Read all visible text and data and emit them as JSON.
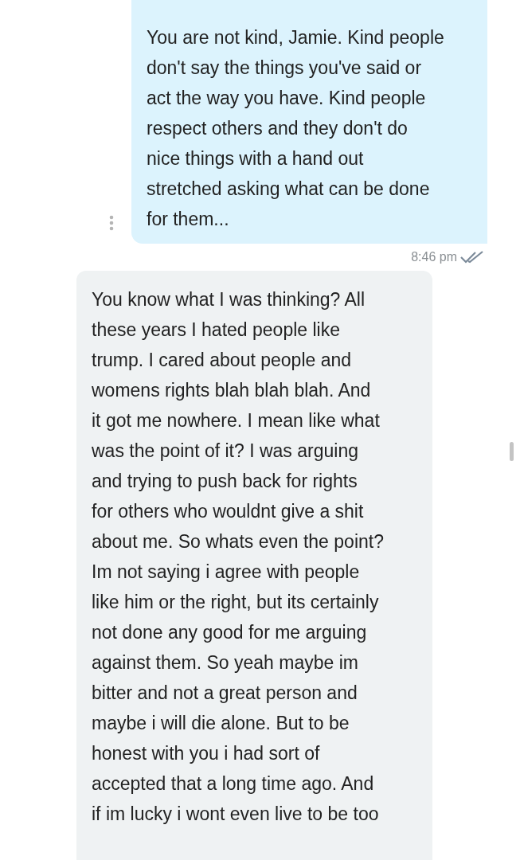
{
  "messages": [
    {
      "kind": "sent",
      "lines": [
        "You are not kind, Jamie. Kind people",
        "don't say the things you've said or",
        "act the way you have. Kind people",
        "respect others and they don't do",
        "nice things with a hand out",
        "stretched asking what can be done",
        "for them..."
      ],
      "time": "8:46 pm",
      "read": true
    },
    {
      "kind": "received",
      "lines": [
        "You know what I was thinking? All",
        "these years I hated people like",
        "trump. I cared about people and",
        "womens rights blah blah blah. And",
        "it got me nowhere. I mean like what",
        "was the point of it? I was arguing",
        "and trying to push back for rights",
        "for others who wouldnt give a shit",
        "about me. So whats even the point?",
        "Im not saying i agree with people",
        "like him or the right, but its certainly",
        "not done any good for me arguing",
        "against them. So yeah maybe im",
        "bitter and not a great person and",
        "maybe i will die alone. But to be",
        "honest with you i had sort of",
        "accepted that a long time ago. And",
        "if im lucky i wont even live to be too"
      ]
    }
  ]
}
